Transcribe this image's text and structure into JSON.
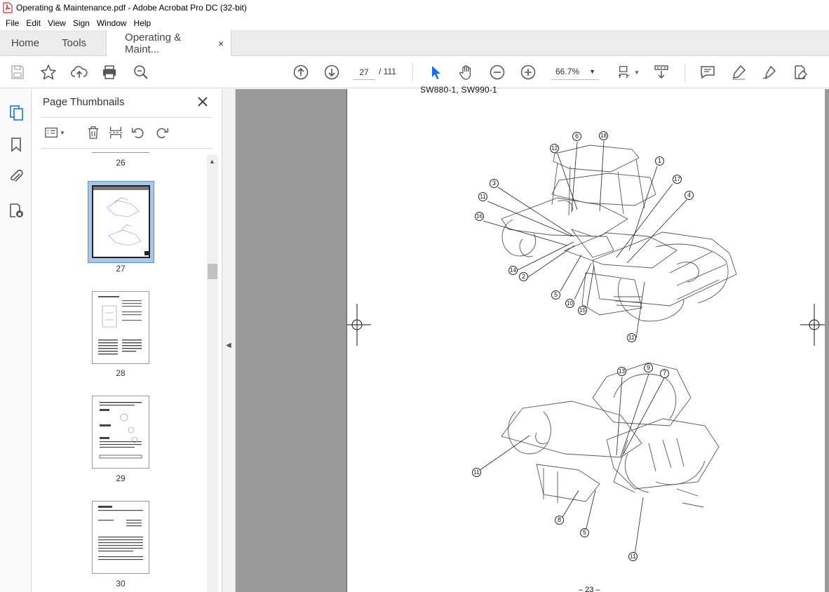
{
  "window": {
    "title": "Operating & Maintenance.pdf - Adobe Acrobat Pro DC (32-bit)"
  },
  "menu": [
    "File",
    "Edit",
    "View",
    "Sign",
    "Window",
    "Help"
  ],
  "tabs": {
    "home": "Home",
    "tools": "Tools",
    "document": "Operating & Maint...",
    "close_symbol": "×"
  },
  "toolbar": {
    "current_page": "27",
    "page_total": "/  111",
    "zoom": "66.7%"
  },
  "thumbnails_panel": {
    "title": "Page Thumbnails",
    "pages": [
      {
        "label": "26"
      },
      {
        "label": "27",
        "selected": true
      },
      {
        "label": "28"
      },
      {
        "label": "29"
      },
      {
        "label": "30"
      }
    ]
  },
  "document": {
    "heading": "SW880-1, SW990-1",
    "page_number": "– 23 –",
    "callouts_top": [
      "6",
      "18",
      "12",
      "1",
      "3",
      "17",
      "11",
      "4",
      "16",
      "14",
      "2",
      "5",
      "10",
      "15",
      "11"
    ],
    "callouts_bottom": [
      "13",
      "9",
      "7",
      "11",
      "8",
      "5",
      "11"
    ]
  }
}
